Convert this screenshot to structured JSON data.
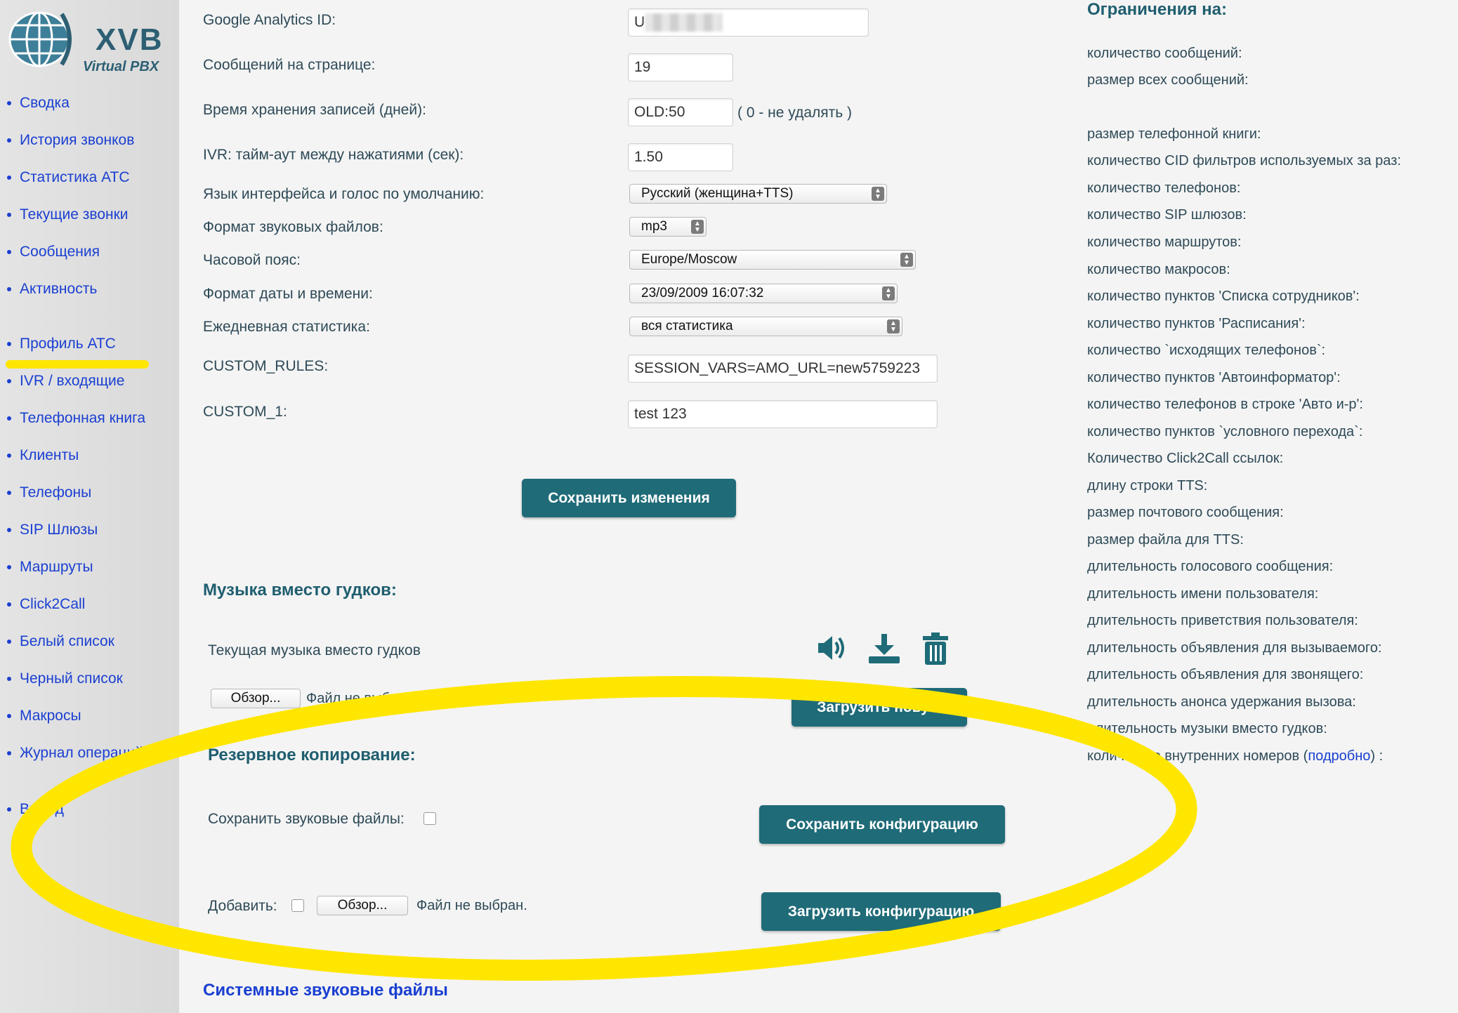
{
  "brand": {
    "name": "XVB",
    "subtitle": "Virtual PBX"
  },
  "sidebar": {
    "items": [
      {
        "label": "Сводка"
      },
      {
        "label": "История звонков"
      },
      {
        "label": "Статистика АТС"
      },
      {
        "label": "Текущие звонки"
      },
      {
        "label": "Сообщения"
      },
      {
        "label": "Активность"
      },
      {
        "label": "Профиль АТС"
      },
      {
        "label": "IVR / входящие"
      },
      {
        "label": "Телефонная книга"
      },
      {
        "label": "Клиенты"
      },
      {
        "label": "Телефоны"
      },
      {
        "label": "SIP Шлюзы"
      },
      {
        "label": "Маршруты"
      },
      {
        "label": "Click2Call"
      },
      {
        "label": "Белый список"
      },
      {
        "label": "Черный список"
      },
      {
        "label": "Макросы"
      },
      {
        "label": "Журнал операций"
      },
      {
        "label": "Выход"
      }
    ]
  },
  "settings": {
    "ga_label": "Google Analytics ID:",
    "ga_value": "U",
    "msgs_label": "Сообщений на странице:",
    "msgs_value": "19",
    "retention_label": "Время хранения записей (дней):",
    "retention_value": "OLD:50",
    "retention_hint": "( 0 - не удалять )",
    "ivr_label": "IVR: тайм-аут между нажатиями (сек):",
    "ivr_value": "1.50",
    "lang_label": "Язык интерфейса и голос по умолчанию:",
    "lang_value": "Русский (женщина+TTS)",
    "format_label": "Формат звуковых файлов:",
    "format_value": "mp3",
    "tz_label": "Часовой пояс:",
    "tz_value": "Europe/Moscow",
    "datefmt_label": "Формат даты и времени:",
    "datefmt_value": "23/09/2009 16:07:32",
    "daily_label": "Ежедневная статистика:",
    "daily_value": "вся статистика",
    "custom_rules_label": "CUSTOM_RULES:",
    "custom_rules_value": "SESSION_VARS=AMO_URL=new5759223",
    "custom1_label": "CUSTOM_1:",
    "custom1_value": "test 123",
    "save_button": "Сохранить изменения"
  },
  "music": {
    "title": "Музыка вместо гудков:",
    "current_label": "Текущая музыка вместо гудков",
    "browse_button": "Обзор...",
    "no_file": "Файл не выбран.",
    "upload_button": "Загрузить новую"
  },
  "backup": {
    "title": "Резервное копирование:",
    "save_sounds_label": "Сохранить звуковые файлы:",
    "save_config_button": "Сохранить конфигурацию",
    "add_label": "Добавить:",
    "browse_button": "Обзор...",
    "no_file": "Файл не выбран.",
    "load_config_button": "Загрузить конфигурацию"
  },
  "system_sounds_title": "Системные звуковые файлы",
  "limits": {
    "title": "Ограничения на:",
    "items": [
      "количество сообщений:",
      "размер всех сообщений:",
      "размер телефонной книги:",
      "количество CID фильтров используемых за раз:",
      "количество телефонов:",
      "количество SIP шлюзов:",
      "количество маршрутов:",
      "количество макросов:",
      "количество пунктов 'Списка сотрудников':",
      "количество пунктов 'Расписания':",
      "количество `исходящих телефонов`:",
      "количество пунктов 'Автоинформатор':",
      "количество телефонов в строке 'Авто и-р':",
      "количество пунктов `условного перехода`:",
      "Количество Click2Call ссылок:",
      "длину строки TTS:",
      "размер почтового сообщения:",
      "размер файла для TTS:",
      "длительность голосового сообщения:",
      "длительность имени пользователя:",
      "длительность приветствия пользователя:",
      "длительность объявления для вызываемого:",
      "длительность объявления для звонящего:",
      "длительность анонса удержания вызова:",
      "длительность музыки вместо гудков:"
    ],
    "last_prefix": "количество внутренних номеров (",
    "last_link": "подробно",
    "last_suffix": ") :"
  },
  "colors": {
    "accent": "#1f6b78",
    "link": "#1a3fd1",
    "highlight": "#ffe600"
  }
}
